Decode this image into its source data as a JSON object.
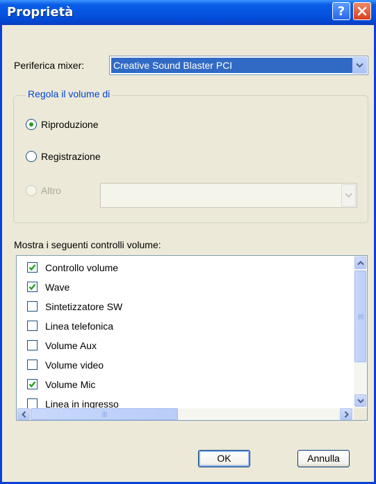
{
  "window": {
    "title": "Proprietà"
  },
  "mixer": {
    "label": "Periferica mixer:",
    "selected": "Creative Sound Blaster PCI"
  },
  "volume_group": {
    "legend": "Regola il volume di",
    "options": [
      {
        "label": "Riproduzione",
        "selected": true,
        "enabled": true
      },
      {
        "label": "Registrazione",
        "selected": false,
        "enabled": true
      },
      {
        "label": "Altro",
        "selected": false,
        "enabled": false
      }
    ],
    "other_combo_value": ""
  },
  "controls": {
    "label": "Mostra i seguenti controlli volume:",
    "items": [
      {
        "label": "Controllo volume",
        "checked": true
      },
      {
        "label": "Wave",
        "checked": true
      },
      {
        "label": "Sintetizzatore SW",
        "checked": false
      },
      {
        "label": "Linea telefonica",
        "checked": false
      },
      {
        "label": "Volume Aux",
        "checked": false
      },
      {
        "label": "Volume video",
        "checked": false
      },
      {
        "label": "Volume Mic",
        "checked": true
      },
      {
        "label": "Linea in ingresso",
        "checked": false
      }
    ]
  },
  "buttons": {
    "ok": "OK",
    "cancel": "Annulla"
  },
  "icons": {
    "help": "question-icon",
    "close": "close-icon",
    "check": "checkmark-icon"
  },
  "colors": {
    "title_bar": "#0553e0",
    "selection": "#316ac5",
    "group_legend": "#0046d5",
    "checkmark": "#21a121",
    "close_button": "#d84020"
  }
}
